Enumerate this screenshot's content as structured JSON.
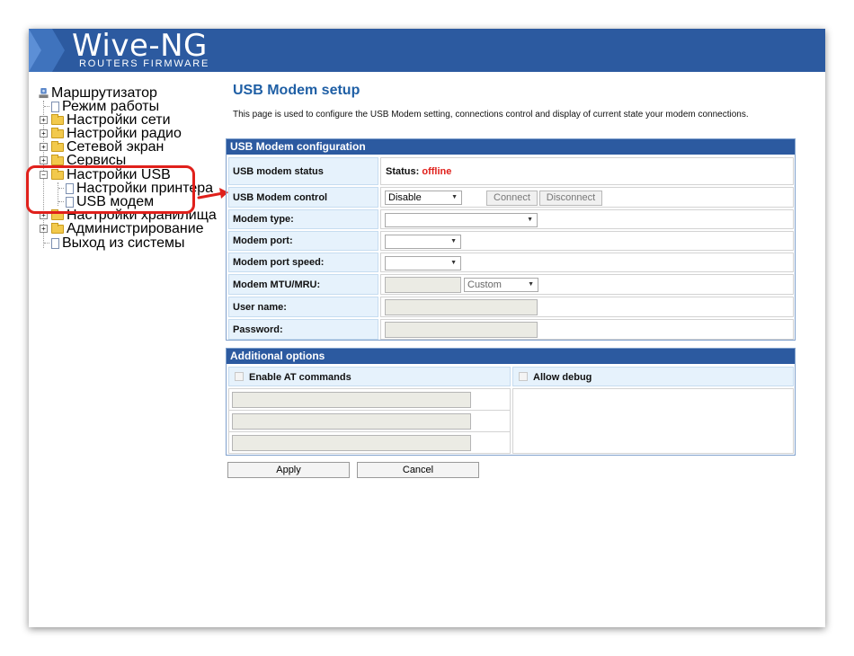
{
  "header": {
    "brand": "Wive-NG",
    "tagline": "ROUTERS FIRMWARE",
    "color": "#2c5aa0"
  },
  "tree": {
    "root": "Маршрутизатор",
    "items": [
      {
        "label": "Режим работы",
        "icon": "page-icon"
      },
      {
        "label": "Настройки сети",
        "icon": "folder-icon"
      },
      {
        "label": "Настройки радио",
        "icon": "folder-icon"
      },
      {
        "label": "Сетевой экран",
        "icon": "folder-icon"
      },
      {
        "label": "Сервисы",
        "icon": "folder-icon"
      },
      {
        "label": "Настройки USB",
        "icon": "folder-open-icon",
        "expanded": true
      },
      {
        "label": "Настройки принтера",
        "icon": "page-icon"
      },
      {
        "label": "USB модем",
        "icon": "page-icon"
      },
      {
        "label": "Настройки хранилища",
        "icon": "folder-icon"
      },
      {
        "label": "Администрирование",
        "icon": "folder-icon"
      },
      {
        "label": "Выход из системы",
        "icon": "page-icon"
      }
    ]
  },
  "page": {
    "title": "USB Modem setup",
    "description": "This page is used to configure the USB Modem setting, connections control and display of current state your modem connections."
  },
  "config": {
    "heading": "USB Modem configuration",
    "status_label": "USB modem status",
    "status_prefix": "Status:",
    "status_value": "offline",
    "control_label": "USB Modem control",
    "control_value": "Disable",
    "connect_label": "Connect",
    "disconnect_label": "Disconnect",
    "modem_type_label": "Modem type:",
    "modem_type_value": "",
    "modem_port_label": "Modem port:",
    "modem_port_value": "",
    "port_speed_label": "Modem port speed:",
    "port_speed_value": "",
    "mtu_label": "Modem MTU/MRU:",
    "mtu_value": "",
    "mtu_mode": "Custom",
    "username_label": "User name:",
    "username_value": "",
    "password_label": "Password:",
    "password_value": ""
  },
  "additional": {
    "heading": "Additional options",
    "at_label": "Enable AT commands",
    "at_checked": false,
    "debug_label": "Allow debug",
    "debug_checked": false,
    "at_commands": [
      "",
      "",
      ""
    ]
  },
  "actions": {
    "apply": "Apply",
    "cancel": "Cancel"
  },
  "annotation": {
    "highlight_color": "#e0201b"
  }
}
